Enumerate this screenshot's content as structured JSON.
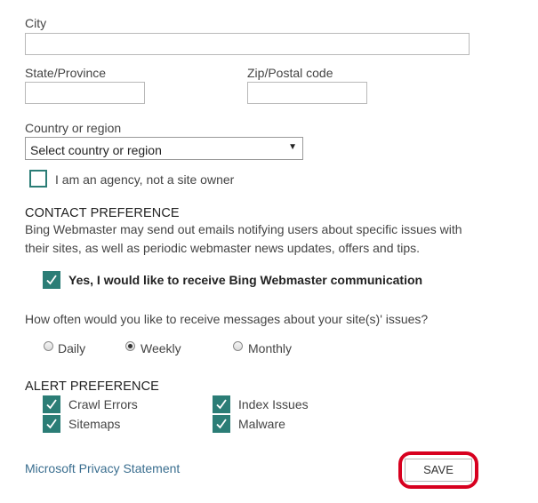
{
  "address": {
    "city_label": "City",
    "city_value": "",
    "state_label": "State/Province",
    "state_value": "",
    "zip_label": "Zip/Postal code",
    "zip_value": "",
    "country_label": "Country or region",
    "country_selected": "Select country or region"
  },
  "agency": {
    "label": "I am an agency, not a site owner",
    "checked": false
  },
  "contact": {
    "heading": "CONTACT PREFERENCE",
    "description_line1": "Bing Webmaster may send out emails notifying users about specific issues with",
    "description_line2": "their sites, as well as periodic webmaster news updates, offers and tips.",
    "optin_label": "Yes, I would like to receive Bing Webmaster communication",
    "optin_checked": true
  },
  "frequency": {
    "question": "How often would you like to receive messages about your site(s)' issues?",
    "options": [
      "Daily",
      "Weekly",
      "Monthly"
    ],
    "selected": "Weekly"
  },
  "alerts": {
    "heading": "ALERT PREFERENCE",
    "items": [
      {
        "label": "Crawl Errors",
        "checked": true
      },
      {
        "label": "Index Issues",
        "checked": true
      },
      {
        "label": "Sitemaps",
        "checked": true
      },
      {
        "label": "Malware",
        "checked": true
      }
    ]
  },
  "footer": {
    "privacy_link": "Microsoft Privacy Statement",
    "save_label": "SAVE"
  },
  "colors": {
    "checkbox_teal": "#2b7d76",
    "highlight_red": "#d7001f",
    "link_blue": "#3a6e8f"
  }
}
